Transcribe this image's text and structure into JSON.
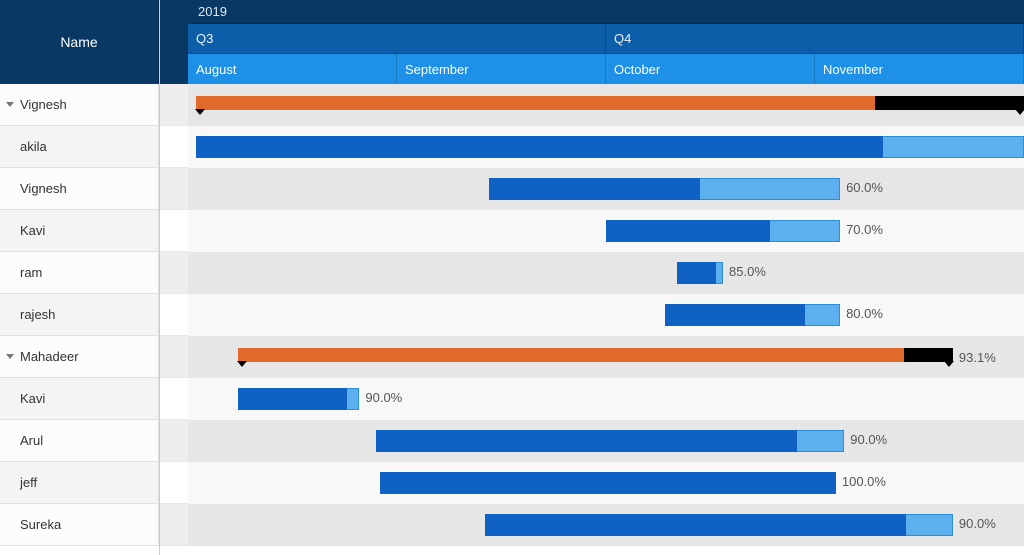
{
  "header": {
    "name_col": "Name",
    "year": "2019",
    "quarters": [
      {
        "label": "Q3",
        "width_pct": 50.0
      },
      {
        "label": "Q4",
        "width_pct": 50.0
      }
    ],
    "months": [
      {
        "label": "August",
        "width_pct": 25.0
      },
      {
        "label": "September",
        "width_pct": 25.0
      },
      {
        "label": "October",
        "width_pct": 25.0
      },
      {
        "label": "November",
        "width_pct": 25.0
      }
    ]
  },
  "rows": [
    {
      "name": "Vignesh",
      "expandable": true,
      "summary": true,
      "start_pct": 1.0,
      "width_pct": 99.0,
      "progress": 82.0,
      "label": ""
    },
    {
      "name": "akila",
      "expandable": false,
      "summary": false,
      "start_pct": 1.0,
      "width_pct": 99.0,
      "progress": 83.0,
      "label": ""
    },
    {
      "name": "Vignesh",
      "expandable": false,
      "summary": false,
      "start_pct": 36.0,
      "width_pct": 42.0,
      "progress": 60.0,
      "label": "60.0%"
    },
    {
      "name": "Kavi",
      "expandable": false,
      "summary": false,
      "start_pct": 50.0,
      "width_pct": 28.0,
      "progress": 70.0,
      "label": "70.0%"
    },
    {
      "name": "ram",
      "expandable": false,
      "summary": false,
      "start_pct": 58.5,
      "width_pct": 5.5,
      "progress": 85.0,
      "label": "85.0%"
    },
    {
      "name": "rajesh",
      "expandable": false,
      "summary": false,
      "start_pct": 57.0,
      "width_pct": 21.0,
      "progress": 80.0,
      "label": "80.0%"
    },
    {
      "name": "Mahadeer",
      "expandable": true,
      "summary": true,
      "start_pct": 6.0,
      "width_pct": 85.5,
      "progress": 93.1,
      "label": "93.1%"
    },
    {
      "name": "Kavi",
      "expandable": false,
      "summary": false,
      "start_pct": 6.0,
      "width_pct": 14.5,
      "progress": 90.0,
      "label": "90.0%"
    },
    {
      "name": "Arul",
      "expandable": false,
      "summary": false,
      "start_pct": 22.5,
      "width_pct": 56.0,
      "progress": 90.0,
      "label": "90.0%"
    },
    {
      "name": "jeff",
      "expandable": false,
      "summary": false,
      "start_pct": 23.0,
      "width_pct": 54.5,
      "progress": 100.0,
      "label": "100.0%"
    },
    {
      "name": "Sureka",
      "expandable": false,
      "summary": false,
      "start_pct": 35.5,
      "width_pct": 56.0,
      "progress": 90.0,
      "label": "90.0%"
    }
  ],
  "chart_data": {
    "type": "gantt",
    "title": "",
    "x_axis": {
      "year": 2019,
      "quarters": [
        "Q3",
        "Q4"
      ],
      "months": [
        "August",
        "September",
        "October",
        "November"
      ]
    },
    "tasks": [
      {
        "name": "Vignesh",
        "type": "summary",
        "start": "2019-08-01",
        "end": "2019-11-30",
        "progress_pct": 82.0
      },
      {
        "name": "akila",
        "type": "task",
        "start": "2019-08-01",
        "end": "2019-11-30",
        "progress_pct": 83.0
      },
      {
        "name": "Vignesh",
        "type": "task",
        "start": "2019-09-12",
        "end": "2019-11-02",
        "progress_pct": 60.0
      },
      {
        "name": "Kavi",
        "type": "task",
        "start": "2019-10-01",
        "end": "2019-11-02",
        "progress_pct": 70.0
      },
      {
        "name": "ram",
        "type": "task",
        "start": "2019-10-09",
        "end": "2019-10-16",
        "progress_pct": 85.0
      },
      {
        "name": "rajesh",
        "type": "task",
        "start": "2019-10-08",
        "end": "2019-11-02",
        "progress_pct": 80.0
      },
      {
        "name": "Mahadeer",
        "type": "summary",
        "start": "2019-08-08",
        "end": "2019-11-18",
        "progress_pct": 93.1
      },
      {
        "name": "Kavi",
        "type": "task",
        "start": "2019-08-08",
        "end": "2019-08-25",
        "progress_pct": 90.0
      },
      {
        "name": "Arul",
        "type": "task",
        "start": "2019-08-28",
        "end": "2019-11-03",
        "progress_pct": 90.0
      },
      {
        "name": "jeff",
        "type": "task",
        "start": "2019-08-28",
        "end": "2019-11-02",
        "progress_pct": 100.0
      },
      {
        "name": "Sureka",
        "type": "task",
        "start": "2019-09-12",
        "end": "2019-11-18",
        "progress_pct": 90.0
      }
    ]
  }
}
